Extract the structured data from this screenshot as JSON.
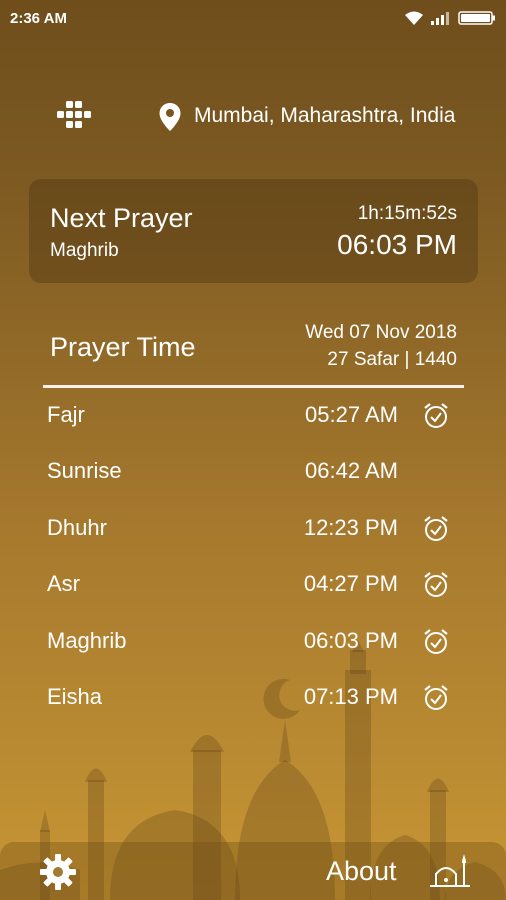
{
  "status_bar": {
    "time": "2:36 AM"
  },
  "header": {
    "location": "Mumbai, Maharashtra, India"
  },
  "next_prayer": {
    "title": "Next Prayer",
    "name": "Maghrib",
    "countdown": "1h:15m:52s",
    "time": "06:03 PM"
  },
  "prayer_time": {
    "title": "Prayer Time",
    "gregorian_date": "Wed 07 Nov 2018",
    "hijri_date": "27 Safar | 1440",
    "prayers": [
      {
        "name": "Fajr",
        "time": "05:27 AM",
        "alarm": true
      },
      {
        "name": "Sunrise",
        "time": "06:42 AM",
        "alarm": false
      },
      {
        "name": "Dhuhr",
        "time": "12:23 PM",
        "alarm": true
      },
      {
        "name": "Asr",
        "time": "04:27 PM",
        "alarm": true
      },
      {
        "name": "Maghrib",
        "time": "06:03 PM",
        "alarm": true
      },
      {
        "name": "Eisha",
        "time": "07:13 PM",
        "alarm": true
      }
    ]
  },
  "bottom_bar": {
    "about_label": "About"
  },
  "icons": {
    "menu": "grid-icon",
    "location": "location-pin-icon",
    "alarm": "alarm-clock-icon",
    "settings": "gear-icon",
    "logo": "mosque-logo-icon"
  },
  "colors": {
    "gradient_top": "#6f4e1c",
    "gradient_bottom": "#c79634",
    "text": "#ffffff"
  }
}
